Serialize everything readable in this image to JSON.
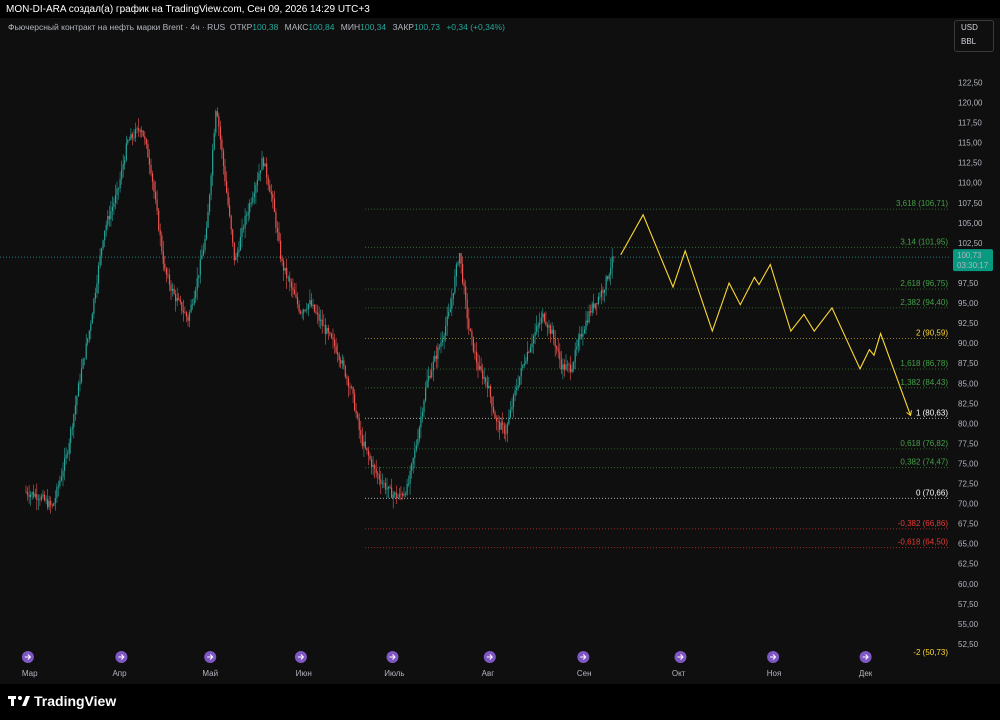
{
  "header": {
    "caption": "MON-DI-ARA создал(а) график на TradingView.com, Сен 09, 2026 14:29 UTC+3"
  },
  "legend": {
    "symbol": "Фьючерсный контракт на нефть марки Brent · 4ч · RUS",
    "open_label": "ОТКР",
    "open": "100,38",
    "high_label": "МАКС",
    "high": "100,84",
    "low_label": "МИН",
    "low": "100,34",
    "close_label": "ЗАКР",
    "close": "100,73",
    "change": "+0,34 (+0,34%)"
  },
  "unit_box": {
    "currency": "USD",
    "unit": "BBL"
  },
  "price_tag": {
    "price": "100,73",
    "countdown": "03:30:17",
    "color": "#089981"
  },
  "branding": {
    "logo_text": "TradingView"
  },
  "chart_data": {
    "type": "candlestick",
    "y_ticks": [
      "52,50",
      "55,00",
      "57,50",
      "60,00",
      "62,50",
      "65,00",
      "67,50",
      "70,00",
      "72,50",
      "75,00",
      "77,50",
      "80,00",
      "82,50",
      "85,00",
      "87,50",
      "90,00",
      "92,50",
      "95,00",
      "97,50",
      "100,00",
      "102,50",
      "105,00",
      "107,50",
      "110,00",
      "112,50",
      "115,00",
      "117,50",
      "120,00",
      "122,50"
    ],
    "ylim": [
      50.5,
      125.3
    ],
    "x_ticks": [
      {
        "label": "Мар",
        "t": 0.04
      },
      {
        "label": "Апр",
        "t": 1.0
      },
      {
        "label": "Май",
        "t": 1.97
      },
      {
        "label": "Июн",
        "t": 2.97
      },
      {
        "label": "Июль",
        "t": 3.94
      },
      {
        "label": "Авг",
        "t": 4.94
      },
      {
        "label": "Сен",
        "t": 5.97
      },
      {
        "label": "Окт",
        "t": 6.98
      },
      {
        "label": "Ноя",
        "t": 8.0
      },
      {
        "label": "Дек",
        "t": 8.98
      }
    ],
    "price_path": [
      [
        0.0,
        71.5
      ],
      [
        0.15,
        71.0
      ],
      [
        0.3,
        69.5
      ],
      [
        0.45,
        76
      ],
      [
        0.6,
        86
      ],
      [
        0.7,
        92
      ],
      [
        0.85,
        104
      ],
      [
        1.0,
        109
      ],
      [
        1.1,
        115
      ],
      [
        1.25,
        117
      ],
      [
        1.35,
        112
      ],
      [
        1.5,
        99
      ],
      [
        1.6,
        96
      ],
      [
        1.75,
        93
      ],
      [
        1.85,
        98
      ],
      [
        1.95,
        104
      ],
      [
        2.05,
        120
      ],
      [
        2.15,
        110
      ],
      [
        2.25,
        100
      ],
      [
        2.35,
        105
      ],
      [
        2.45,
        109
      ],
      [
        2.55,
        113
      ],
      [
        2.65,
        108
      ],
      [
        2.75,
        100
      ],
      [
        2.85,
        97
      ],
      [
        2.95,
        94
      ],
      [
        3.05,
        95
      ],
      [
        3.2,
        92
      ],
      [
        3.35,
        89
      ],
      [
        3.5,
        84
      ],
      [
        3.6,
        78
      ],
      [
        3.75,
        74
      ],
      [
        3.9,
        71.5
      ],
      [
        4.0,
        70.8
      ],
      [
        4.1,
        72
      ],
      [
        4.2,
        78
      ],
      [
        4.3,
        85
      ],
      [
        4.45,
        90
      ],
      [
        4.55,
        94
      ],
      [
        4.65,
        101.5
      ],
      [
        4.75,
        92
      ],
      [
        4.85,
        87
      ],
      [
        4.95,
        85
      ],
      [
        5.05,
        80
      ],
      [
        5.15,
        79
      ],
      [
        5.25,
        84
      ],
      [
        5.35,
        88
      ],
      [
        5.45,
        91
      ],
      [
        5.55,
        93.5
      ],
      [
        5.65,
        91
      ],
      [
        5.75,
        87
      ],
      [
        5.85,
        87
      ],
      [
        5.95,
        91
      ],
      [
        6.05,
        94
      ],
      [
        6.2,
        97
      ],
      [
        6.3,
        100.7
      ]
    ],
    "projection": [
      [
        6.36,
        101.0
      ],
      [
        6.6,
        106.0
      ],
      [
        6.92,
        97.0
      ],
      [
        7.05,
        101.5
      ],
      [
        7.34,
        91.5
      ],
      [
        7.52,
        97.5
      ],
      [
        7.64,
        94.8
      ],
      [
        7.79,
        98.2
      ],
      [
        7.84,
        97.3
      ],
      [
        7.96,
        99.8
      ],
      [
        8.18,
        91.5
      ],
      [
        8.32,
        93.6
      ],
      [
        8.43,
        91.5
      ],
      [
        8.62,
        94.4
      ],
      [
        8.92,
        86.8
      ],
      [
        9.02,
        89.2
      ],
      [
        9.07,
        88.5
      ],
      [
        9.14,
        91.2
      ],
      [
        9.46,
        81.0
      ]
    ],
    "fib_levels": [
      {
        "label": "3,618 (106,71)",
        "value": 106.71,
        "color": "#43a047"
      },
      {
        "label": "3,14 (101,95)",
        "value": 101.95,
        "color": "#43a047"
      },
      {
        "label": "2,618 (96,75)",
        "value": 96.75,
        "color": "#43a047"
      },
      {
        "label": "2,382 (94,40)",
        "value": 94.4,
        "color": "#43a047"
      },
      {
        "label": "2 (90,59)",
        "value": 90.59,
        "color": "#fdd835"
      },
      {
        "label": "1,618 (86,78)",
        "value": 86.78,
        "color": "#43a047"
      },
      {
        "label": "1,382 (84,43)",
        "value": 84.43,
        "color": "#43a047"
      },
      {
        "label": "1 (80,63)",
        "value": 80.63,
        "color": "#ffffff"
      },
      {
        "label": "0,618 (76,82)",
        "value": 76.82,
        "color": "#43a047"
      },
      {
        "label": "0,382 (74,47)",
        "value": 74.47,
        "color": "#43a047"
      },
      {
        "label": "0 (70,66)",
        "value": 70.66,
        "color": "#ffffff"
      },
      {
        "label": "-0,382 (66,86)",
        "value": 66.86,
        "color": "#e53935"
      },
      {
        "label": "-0,618 (64,50)",
        "value": 64.5,
        "color": "#e53935"
      },
      {
        "label": "-2 (50,73)",
        "value": 50.73,
        "color": "#fdd835"
      }
    ],
    "current_price": 100.73,
    "event_markers_t": [
      0.02,
      1.02,
      1.97,
      2.94,
      3.92,
      4.96,
      5.96,
      7.0,
      7.99,
      8.98
    ],
    "colors": {
      "up": "#26a69a",
      "down": "#ef5350",
      "projection": "#fdd835",
      "marker": "#7e57c2"
    }
  }
}
